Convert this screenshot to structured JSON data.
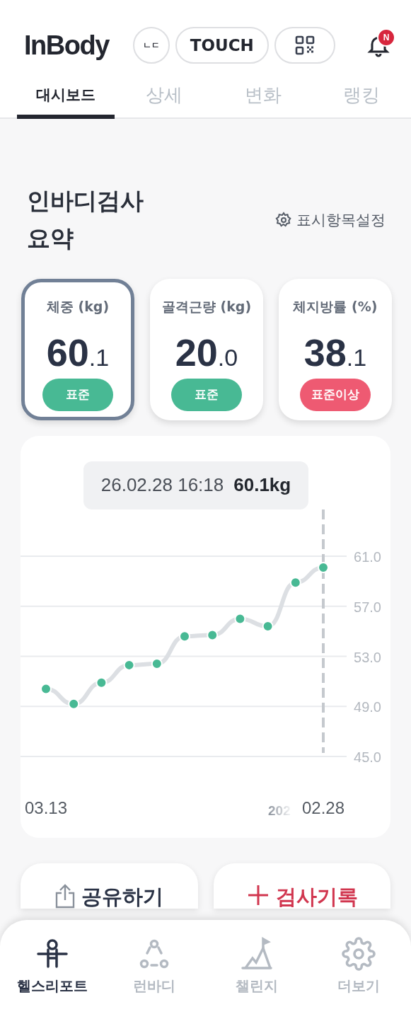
{
  "header": {
    "logo": "InBody",
    "lang_button": "ㄴㄷ",
    "touch_button": "TOUCH",
    "notification_badge": "N"
  },
  "tabs": [
    {
      "label": "대시보드",
      "selected": true
    },
    {
      "label": "상세",
      "selected": false
    },
    {
      "label": "변화",
      "selected": false
    },
    {
      "label": "랭킹",
      "selected": false
    }
  ],
  "summary": {
    "title": "인바디검사\n요약",
    "settings_link": "표시항목설정"
  },
  "metrics": [
    {
      "label": "체중 (kg)",
      "integer": "60",
      "decimal": ".1",
      "status": "표준",
      "color": "#48b994",
      "selected": true
    },
    {
      "label": "골격근량 (kg)",
      "integer": "20",
      "decimal": ".0",
      "status": "표준",
      "color": "#48b994",
      "selected": false
    },
    {
      "label": "체지방률 (%)",
      "integer": "38",
      "decimal": ".1",
      "status": "표준이상",
      "color": "#ee5a72",
      "selected": false
    }
  ],
  "chart": {
    "tooltip_date": "26.02.28 16:18",
    "tooltip_value": "60.1kg",
    "year_fragment": "202",
    "chart_data": {
      "type": "line",
      "categories": [
        "03.13",
        null,
        null,
        null,
        null,
        null,
        null,
        null,
        null,
        null,
        "02.28"
      ],
      "ylim": [
        45,
        61
      ],
      "yticks": [
        {
          "value": 61,
          "label": "61.0"
        },
        {
          "value": 57,
          "label": "57.0"
        },
        {
          "value": 53,
          "label": "53.0"
        },
        {
          "value": 49,
          "label": "49.0"
        },
        {
          "value": 45,
          "label": "45.0"
        }
      ],
      "grid": true,
      "series": [
        {
          "color": "#dcdfe3",
          "marker": "circle",
          "values": [
            50.4,
            49.2,
            50.9,
            52.3,
            52.4,
            54.6,
            54.7,
            56.0,
            55.4,
            58.9,
            60.1
          ]
        }
      ]
    }
  },
  "actions": [
    {
      "kind": "share",
      "label": "공유하기"
    },
    {
      "kind": "add",
      "label": "검사기록"
    }
  ],
  "bottom_nav": [
    {
      "kind": "health",
      "label": "헬스리포트",
      "selected": true
    },
    {
      "kind": "runbody",
      "label": "런바디",
      "selected": false
    },
    {
      "kind": "challenge",
      "label": "챌린지",
      "selected": false
    },
    {
      "kind": "more",
      "label": "더보기",
      "selected": false
    }
  ]
}
